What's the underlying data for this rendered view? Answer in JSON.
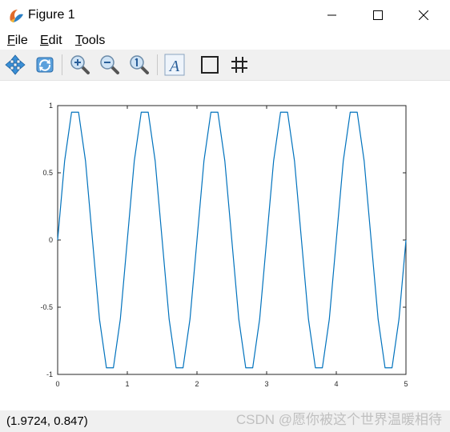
{
  "window": {
    "title": "Figure 1"
  },
  "menu": {
    "file": {
      "mnemonic": "F",
      "rest": "ile"
    },
    "edit": {
      "mnemonic": "E",
      "rest": "dit"
    },
    "tools": {
      "mnemonic": "T",
      "rest": "ools"
    }
  },
  "toolbar": {
    "buttons": [
      "pan-icon",
      "rotate-icon",
      "zoom-in-icon",
      "zoom-out-icon",
      "zoom-reset-icon",
      "text-icon",
      "axes-box-icon",
      "grid-icon"
    ],
    "text_tool_letter": "A"
  },
  "status": {
    "coordinates": "(1.9724, 0.847)",
    "watermark": "CSDN @愿你被这个世界温暖相待"
  },
  "colors": {
    "line": "#0072bd",
    "toolbar_bg": "#f0f0f0",
    "statusbar_bg": "#f0f0f0"
  },
  "chart_data": {
    "type": "line",
    "title": "",
    "xlabel": "",
    "ylabel": "",
    "xlim": [
      0,
      5
    ],
    "ylim": [
      -1,
      1
    ],
    "xticks": [
      "0",
      "1",
      "2",
      "3",
      "4",
      "5"
    ],
    "yticks": [
      "1",
      "0.5",
      "0",
      "-0.5",
      "-1"
    ],
    "grid": false,
    "x": [
      0,
      0.1,
      0.2,
      0.3,
      0.4,
      0.5,
      0.6,
      0.7,
      0.8,
      0.9,
      1,
      1.1,
      1.2,
      1.3,
      1.4,
      1.5,
      1.6,
      1.7,
      1.8,
      1.9,
      2,
      2.1,
      2.2,
      2.3,
      2.4,
      2.5,
      2.6,
      2.7,
      2.8,
      2.9,
      3,
      3.1,
      3.2,
      3.3,
      3.4,
      3.5,
      3.6,
      3.7,
      3.8,
      3.9,
      4,
      4.1,
      4.2,
      4.3,
      4.4,
      4.5,
      4.6,
      4.7,
      4.8,
      4.9,
      5
    ],
    "series": [
      {
        "values": [
          0,
          0.5878,
          0.9511,
          0.9511,
          0.5878,
          0,
          -0.5878,
          -0.9511,
          -0.9511,
          -0.5878,
          0,
          0.5878,
          0.9511,
          0.9511,
          0.5878,
          0,
          -0.5878,
          -0.9511,
          -0.9511,
          -0.5878,
          0,
          0.5878,
          0.9511,
          0.9511,
          0.5878,
          0,
          -0.5878,
          -0.9511,
          -0.9511,
          -0.5878,
          0,
          0.5878,
          0.9511,
          0.9511,
          0.5878,
          0,
          -0.5878,
          -0.9511,
          -0.9511,
          -0.5878,
          0,
          0.5878,
          0.9511,
          0.9511,
          0.5878,
          0,
          -0.5878,
          -0.9511,
          -0.9511,
          -0.5878,
          0
        ]
      }
    ]
  }
}
